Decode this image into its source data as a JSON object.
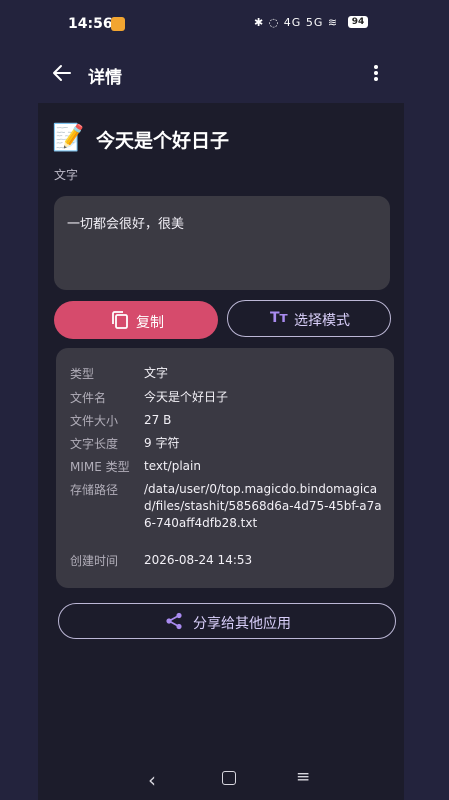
{
  "status_bar": {
    "time": "14:56",
    "icons": "✱ ◌ 4G 5G ≋",
    "battery": "94"
  },
  "app_bar": {
    "title": "详情",
    "back_icon": "arrow-left-icon",
    "more_icon": "more-vert-icon"
  },
  "item": {
    "icon": "📝",
    "title": "今天是个好日子",
    "type_label": "文字",
    "content": "一切都会很好，很美"
  },
  "actions": {
    "copy_label": "复制",
    "select_icon_text": "Tт",
    "select_label": "选择模式",
    "share_label": "分享给其他应用"
  },
  "info": {
    "rows": [
      {
        "key": "类型",
        "value": "文字"
      },
      {
        "key": "文件名",
        "value": "今天是个好日子"
      },
      {
        "key": "文件大小",
        "value": "27 B"
      },
      {
        "key": "文字长度",
        "value": "9 字符"
      },
      {
        "key": "MIME 类型",
        "value": "text/plain"
      },
      {
        "key": "存储路径",
        "value": "/data/user/0/top.magicdo.bindomagicad/files/stashit/58568d6a-4d75-45bf-a7a6-740aff4dfb28.txt"
      },
      {
        "key": "创建时间",
        "value": "2026-08-24 14:53"
      }
    ]
  },
  "navbar": {
    "back": "‹",
    "menu": "≡"
  },
  "colors": {
    "background": "#23233d",
    "panel": "#1c1c2b",
    "card": "#3a3943",
    "copy_button": "#d64b6c",
    "accent_purple": "#a98bf0"
  }
}
